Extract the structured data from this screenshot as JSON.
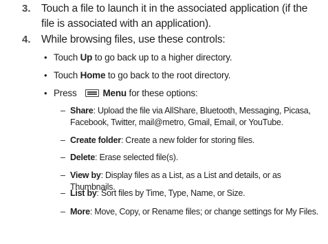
{
  "steps": [
    {
      "number": "3.",
      "text_line1": "Touch a file to launch it in the associated application (if the",
      "text_line2": "file is associated with an application)."
    },
    {
      "number": "4.",
      "text": "While browsing files, use these controls:"
    }
  ],
  "bullets": [
    {
      "prefix": "Touch ",
      "bold": "Up",
      "suffix": " to go back up to a higher directory."
    },
    {
      "prefix": "Touch ",
      "bold": "Home",
      "suffix": " to go back to the root directory."
    },
    {
      "prefix": "Press",
      "icon": "menu-key-icon",
      "bold": "Menu",
      "suffix": " for these options:"
    }
  ],
  "menu_options": [
    {
      "label": "Share",
      "line1": ": Upload the file via AllShare, Bluetooth, Messaging, Picasa,",
      "line2": "Facebook, Twitter, mail@metro, Gmail, Email, or YouTube."
    },
    {
      "label": "Create folder",
      "line1": ": Create a new folder for storing files."
    },
    {
      "label": "Delete",
      "line1": ": Erase selected file(s)."
    },
    {
      "label": "View by",
      "line1": ":  Display files as a List, as a List and details, or as Thumbnails."
    },
    {
      "label": "List by",
      "line1": ": Sort files by Time, Type, Name, or Size."
    },
    {
      "label": "More",
      "line1": ": Move, Copy, or Rename files; or change settings for My Files."
    }
  ],
  "bullet_symbol": "•",
  "dash_symbol": "–"
}
